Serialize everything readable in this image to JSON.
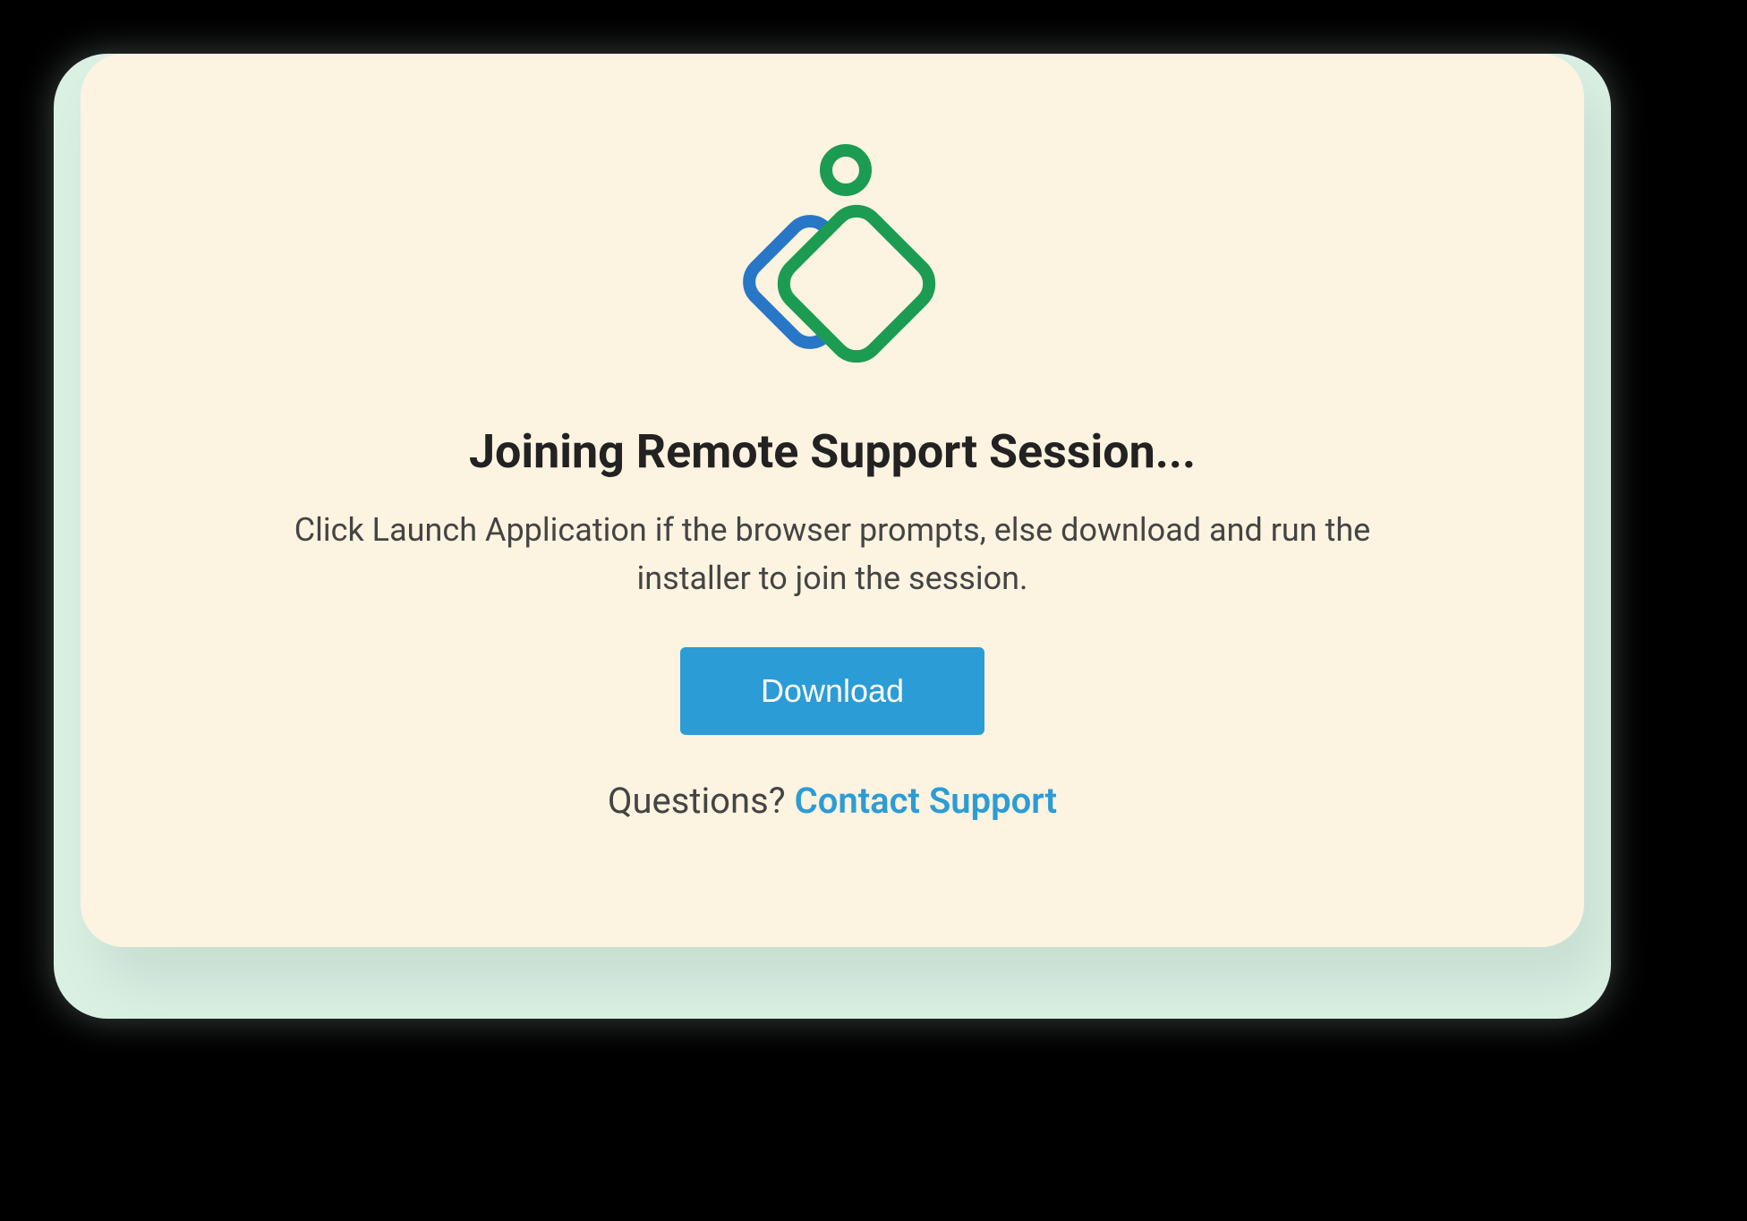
{
  "card": {
    "heading": "Joining Remote Support Session...",
    "description": "Click Launch Application if the browser prompts, else download and run the installer to join the session.",
    "download_label": "Download",
    "questions_label": "Questions? ",
    "contact_support_label": "Contact Support"
  },
  "colors": {
    "accent_blue": "#2c9cd6",
    "logo_green": "#1c9c52",
    "logo_blue": "#2877c7",
    "card_bg": "#fcf3e0",
    "shadow_bg": "#d9f0e3"
  }
}
